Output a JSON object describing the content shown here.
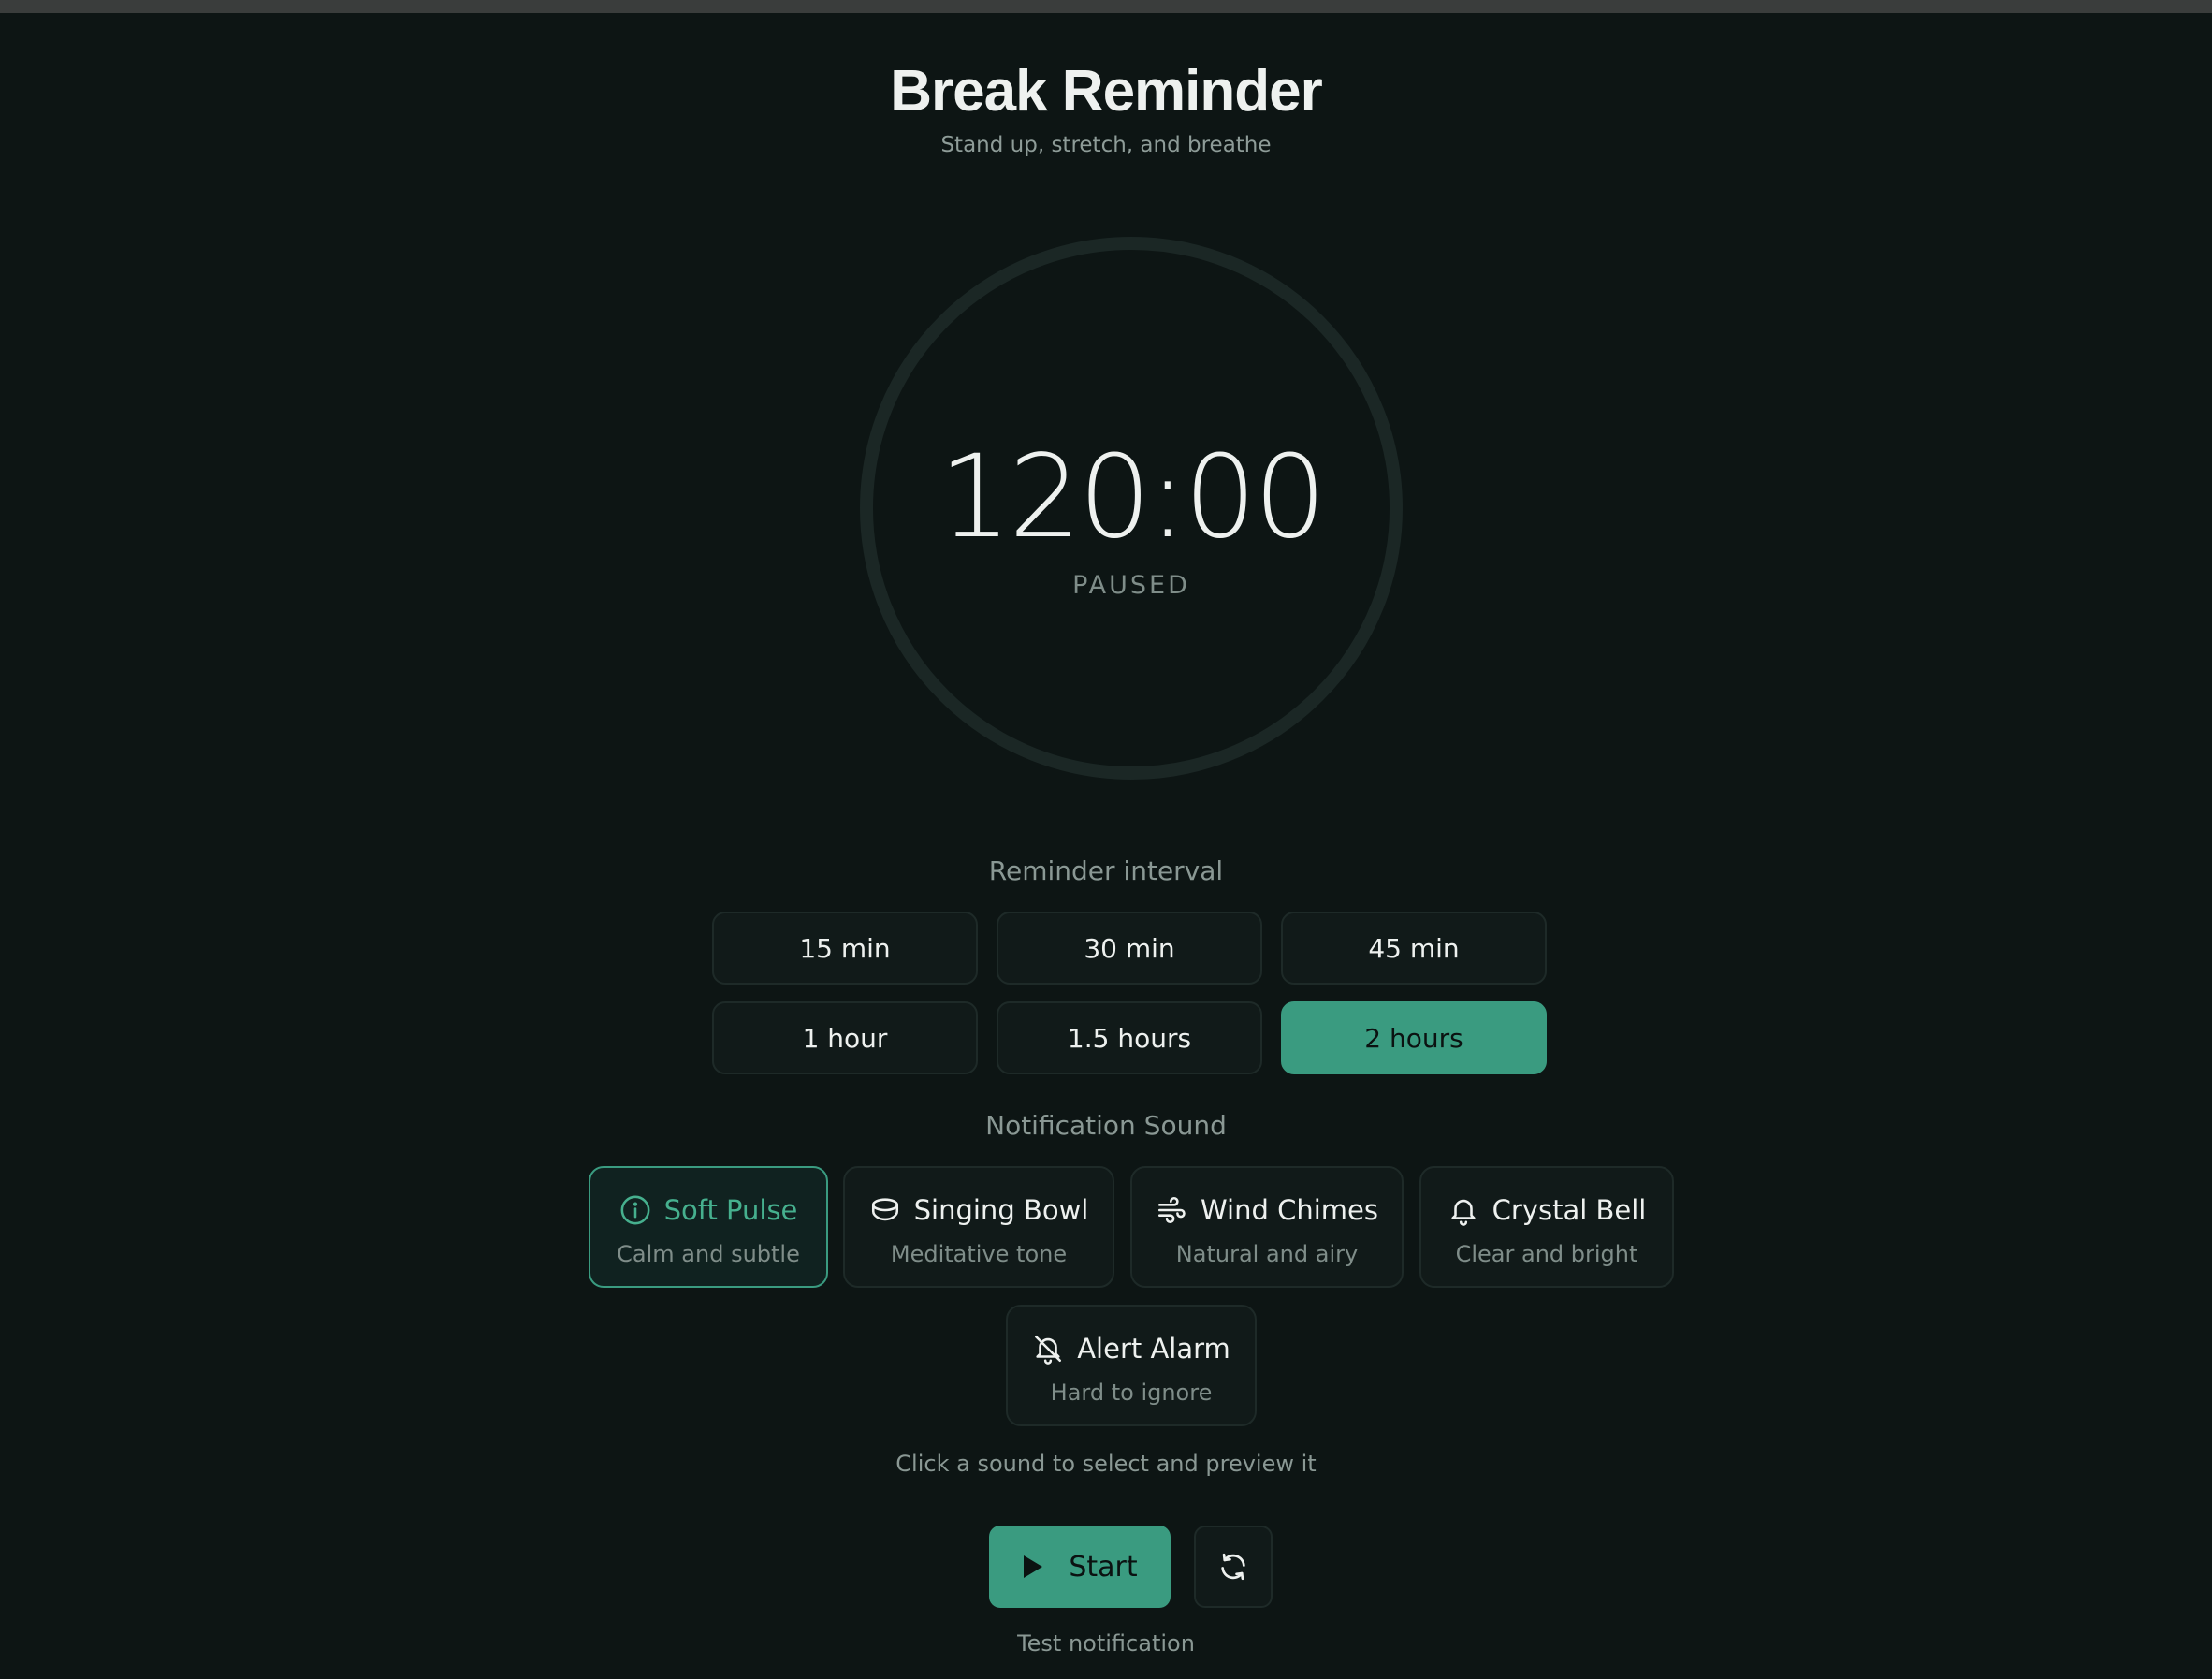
{
  "header": {
    "title": "Break Reminder",
    "subtitle": "Stand up, stretch, and breathe"
  },
  "timer": {
    "display": "120:00",
    "status": "PAUSED",
    "progress_fraction": 0
  },
  "interval": {
    "label": "Reminder interval",
    "options": [
      "15 min",
      "30 min",
      "45 min",
      "1 hour",
      "1.5 hours",
      "2 hours"
    ],
    "selected": "2 hours"
  },
  "sound": {
    "label": "Notification Sound",
    "options": [
      {
        "name": "Soft Pulse",
        "desc": "Calm and subtle",
        "icon": "info-circle-icon"
      },
      {
        "name": "Singing Bowl",
        "desc": "Meditative tone",
        "icon": "bowl-icon"
      },
      {
        "name": "Wind Chimes",
        "desc": "Natural and airy",
        "icon": "wind-icon"
      },
      {
        "name": "Crystal Bell",
        "desc": "Clear and bright",
        "icon": "bell-icon"
      },
      {
        "name": "Alert Alarm",
        "desc": "Hard to ignore",
        "icon": "bell-off-icon"
      }
    ],
    "selected": "Soft Pulse",
    "hint": "Click a sound to select and preview it"
  },
  "controls": {
    "start_label": "Start",
    "reset_icon": "refresh-icon",
    "test_label": "Test notification"
  },
  "colors": {
    "background": "#0d1514",
    "accent": "#3a9b80",
    "ring_track": "#1b2725"
  }
}
